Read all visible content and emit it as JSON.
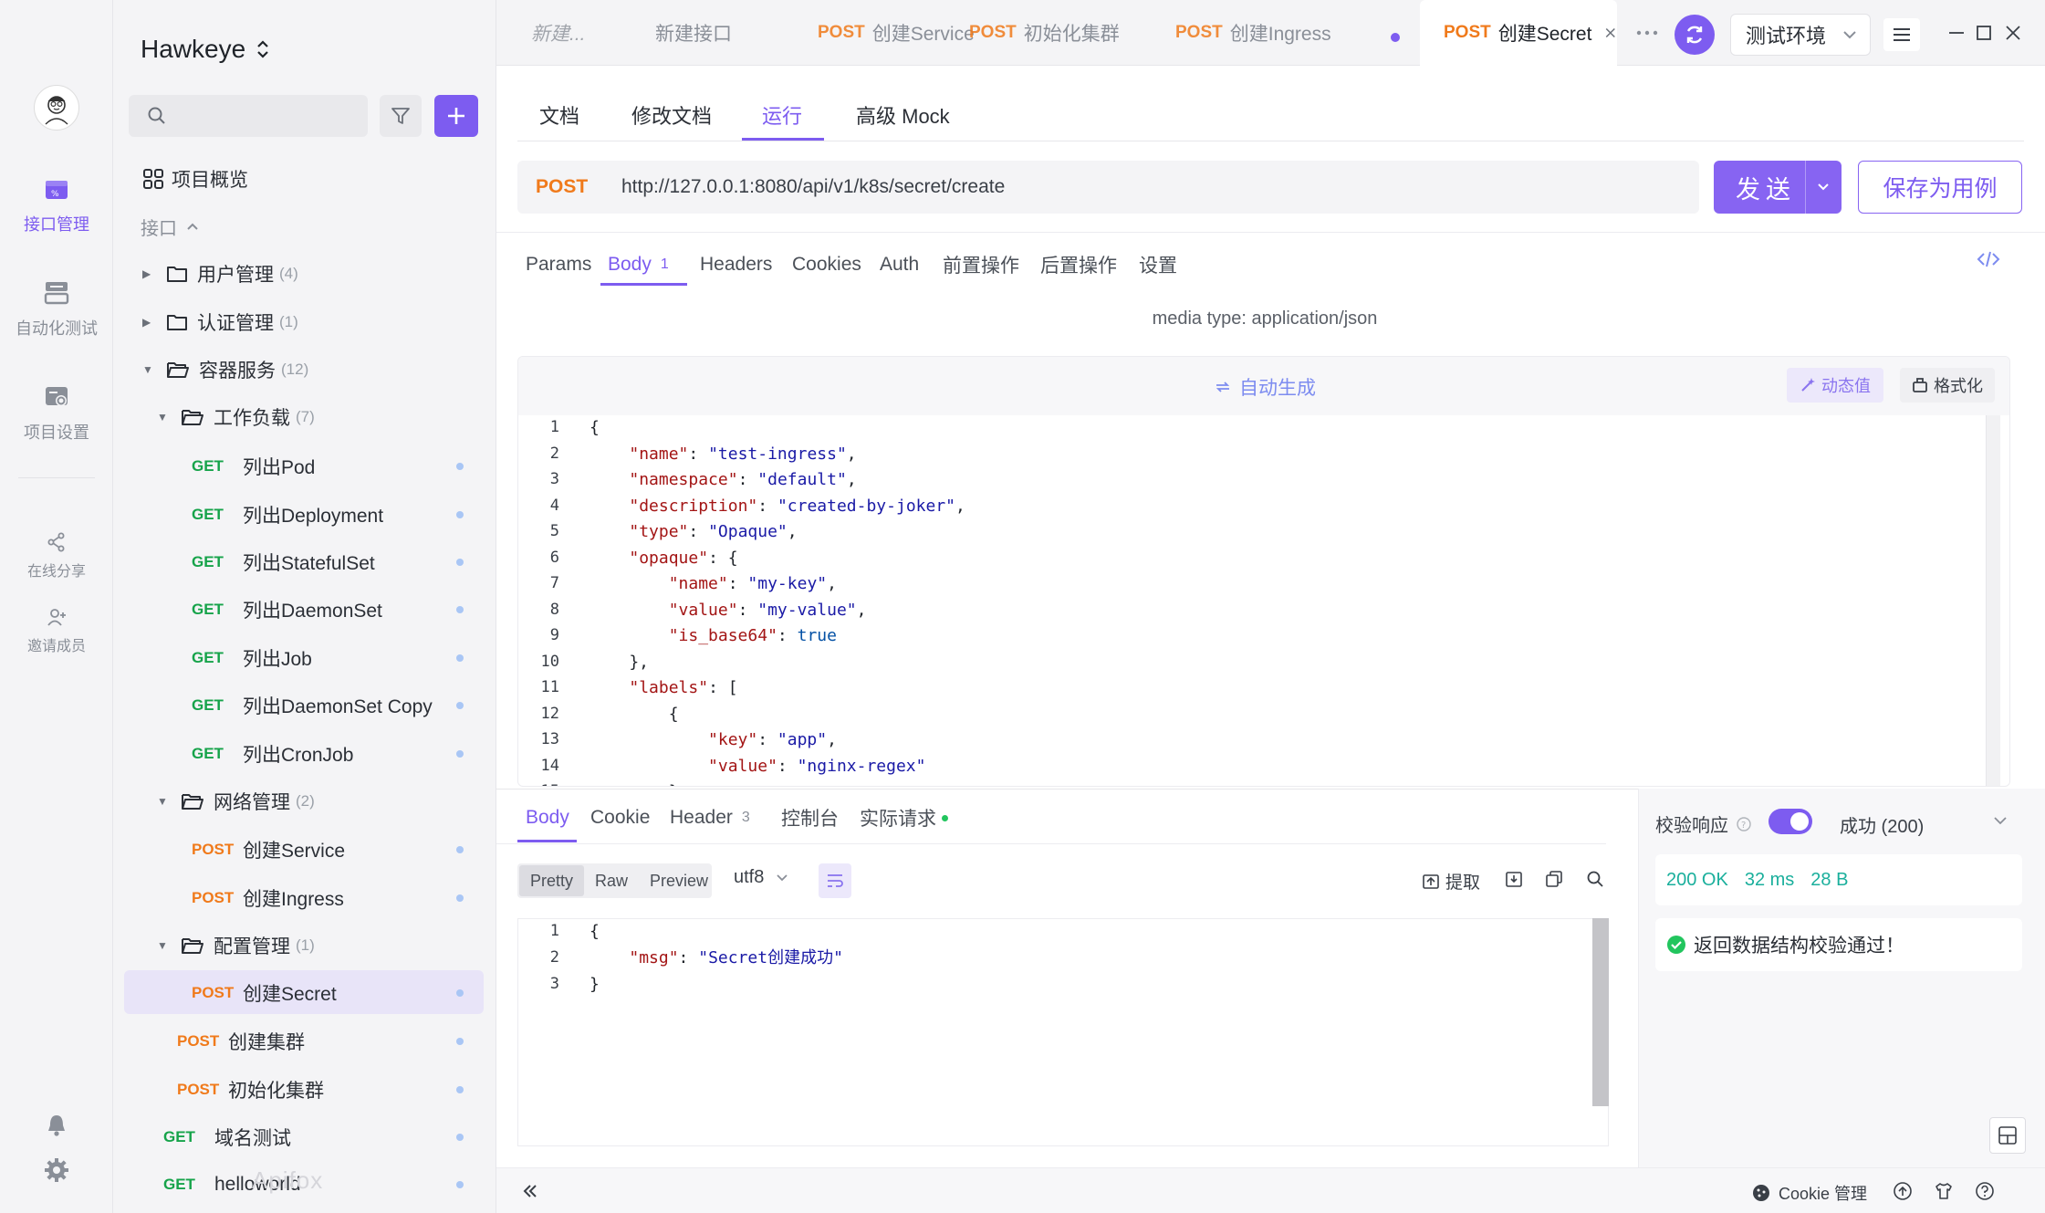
{
  "nav": {
    "items": [
      {
        "label": "接口管理"
      },
      {
        "label": "自动化测试"
      },
      {
        "label": "项目设置"
      },
      {
        "label": "在线分享"
      },
      {
        "label": "邀请成员"
      }
    ]
  },
  "sidebar": {
    "project_name": "Hawkeye",
    "search": {
      "placeholder": "",
      "value": ""
    },
    "overview_label": "项目概览",
    "section_label": "接口",
    "folders": {
      "user": {
        "name": "用户管理",
        "count": "(4)"
      },
      "auth": {
        "name": "认证管理",
        "count": "(1)"
      },
      "container": {
        "name": "容器服务",
        "count": "(12)"
      },
      "workload": {
        "name": "工作负载",
        "count": "(7)"
      },
      "network": {
        "name": "网络管理",
        "count": "(2)"
      },
      "config": {
        "name": "配置管理",
        "count": "(1)"
      }
    },
    "apis": [
      {
        "method": "GET",
        "name": "列出Pod"
      },
      {
        "method": "GET",
        "name": "列出Deployment"
      },
      {
        "method": "GET",
        "name": "列出StatefulSet"
      },
      {
        "method": "GET",
        "name": "列出DaemonSet"
      },
      {
        "method": "GET",
        "name": "列出Job"
      },
      {
        "method": "GET",
        "name": "列出DaemonSet Copy"
      },
      {
        "method": "GET",
        "name": "列出CronJob"
      },
      {
        "method": "POST",
        "name": "创建Service"
      },
      {
        "method": "POST",
        "name": "创建Ingress"
      },
      {
        "method": "POST",
        "name": "创建Secret"
      },
      {
        "method": "POST",
        "name": "创建集群"
      },
      {
        "method": "POST",
        "name": "初始化集群"
      },
      {
        "method": "GET",
        "name": "域名测试"
      },
      {
        "method": "GET",
        "name": "helloworld"
      }
    ],
    "watermark": "Apifox"
  },
  "tabs": [
    {
      "method": "",
      "title": "新建..."
    },
    {
      "method": "",
      "title": "新建接口"
    },
    {
      "method": "POST",
      "title": "创建Service"
    },
    {
      "method": "POST",
      "title": "初始化集群"
    },
    {
      "method": "POST",
      "title": "创建Ingress"
    },
    {
      "method": "POST",
      "title": "创建Secret"
    }
  ],
  "environment": "测试环境",
  "doc_tabs": [
    "文档",
    "修改文档",
    "运行",
    "高级 Mock"
  ],
  "request": {
    "method": "POST",
    "url": "http://127.0.0.1:8080/api/v1/k8s/secret/create",
    "send_label": "发送",
    "save_case_label": "保存为用例",
    "tabs": [
      {
        "label": "Params",
        "badge": ""
      },
      {
        "label": "Body",
        "badge": "1"
      },
      {
        "label": "Headers",
        "badge": ""
      },
      {
        "label": "Cookies",
        "badge": ""
      },
      {
        "label": "Auth",
        "badge": ""
      },
      {
        "label": "前置操作",
        "badge": ""
      },
      {
        "label": "后置操作",
        "badge": ""
      },
      {
        "label": "设置",
        "badge": ""
      }
    ],
    "media_type": "media type: application/json",
    "auto_generate_label": "自动生成",
    "dynamic_value_label": "动态值",
    "format_label": "格式化",
    "body_lines": [
      "{",
      "    \"name\": \"test-ingress\",",
      "    \"namespace\": \"default\",",
      "    \"description\": \"created-by-joker\",",
      "    \"type\": \"Opaque\",",
      "    \"opaque\": {",
      "        \"name\": \"my-key\",",
      "        \"value\": \"my-value\",",
      "        \"is_base64\": true",
      "    },",
      "    \"labels\": [",
      "        {",
      "            \"key\": \"app\",",
      "            \"value\": \"nginx-regex\"",
      "        }"
    ]
  },
  "response": {
    "tabs": [
      {
        "label": "Body",
        "badge": ""
      },
      {
        "label": "Cookie",
        "badge": ""
      },
      {
        "label": "Header",
        "badge": "3"
      },
      {
        "label": "控制台",
        "badge": ""
      },
      {
        "label": "实际请求",
        "badge": ""
      }
    ],
    "views": [
      "Pretty",
      "Raw",
      "Preview"
    ],
    "encoding": "utf8",
    "extract_label": "提取",
    "body_lines": [
      "{",
      "    \"msg\": \"Secret创建成功\"",
      "}"
    ]
  },
  "validation": {
    "label": "校验响应",
    "enabled": true,
    "result": "成功 (200)",
    "status": "200 OK",
    "time": "32 ms",
    "size": "28 B",
    "message": "返回数据结构校验通过！"
  },
  "statusbar": {
    "cookie_label": "Cookie 管理"
  },
  "colors": {
    "accent": "#7d5cf0",
    "get": "#16a34a",
    "post": "#f07a1b",
    "success": "#1aaf9c"
  }
}
